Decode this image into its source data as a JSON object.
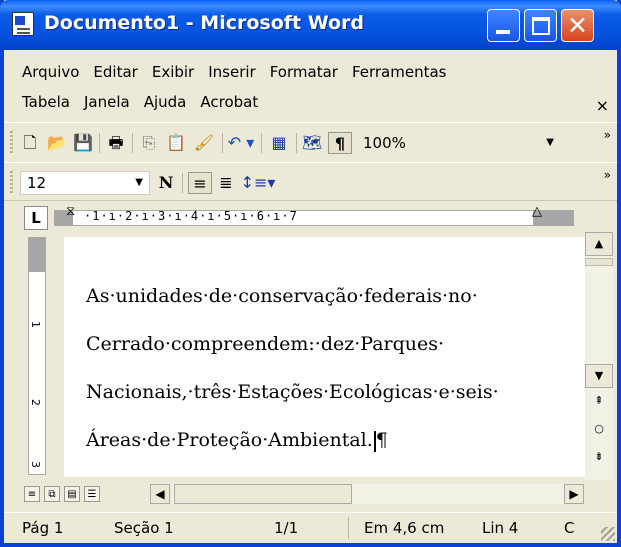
{
  "window": {
    "title": "Documento1 - Microsoft Word",
    "icon": "word-document-icon",
    "controls": [
      "minimize-icon",
      "maximize-icon",
      "close-icon"
    ]
  },
  "menus": {
    "row1": [
      "Arquivo",
      "Editar",
      "Exibir",
      "Inserir",
      "Formatar",
      "Ferramentas"
    ],
    "row2": [
      "Tabela",
      "Janela",
      "Ajuda",
      "Acrobat"
    ],
    "close_glyph": "×"
  },
  "toolbar_standard": {
    "zoom": "100%",
    "overflow_glyph": "»",
    "icons": [
      "new-document-icon",
      "open-folder-icon",
      "save-icon",
      "print-icon",
      "copy-icon",
      "paste-icon",
      "format-painter-icon",
      "undo-icon",
      "table-icon",
      "document-map-icon",
      "show-formatting-icon"
    ]
  },
  "toolbar_format": {
    "font_size": "12",
    "overflow_glyph": "»",
    "bold_glyph": "N",
    "icons": [
      "bold-icon",
      "align-left-icon",
      "align-center-icon",
      "line-spacing-icon"
    ]
  },
  "ruler": {
    "tab_selector": "L",
    "numbers": "·1·ı·2·ı·3·ı·4·ı·5·ı·6·ı·7"
  },
  "vertical_ruler": {
    "marks": [
      "1",
      "2",
      "3"
    ]
  },
  "document": {
    "lines": [
      "As·unidades·de·conservação·federais·no·",
      "Cerrado·compreendem:·dez·Parques·",
      "Nacionais,·três·Estações·Ecológicas·e·seis·",
      "Áreas·de·Proteção·Ambiental."
    ],
    "pilcrow": "¶"
  },
  "statusbar": {
    "page": "Pág 1",
    "section": "Seção 1",
    "pages": "1/1",
    "position": "Em 4,6 cm",
    "line": "Lin 4",
    "col": "C"
  },
  "colors": {
    "titlebar": "#0a5be8",
    "chrome": "#ece9d8",
    "close_button": "#d8441a"
  }
}
